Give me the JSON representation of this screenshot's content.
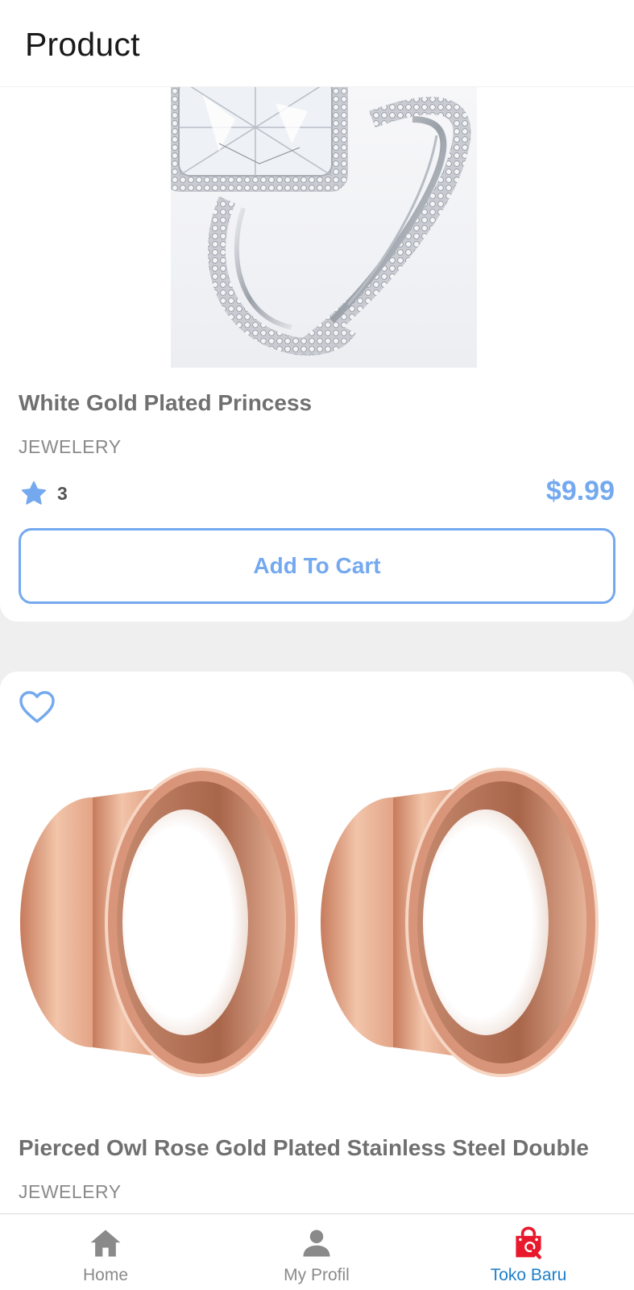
{
  "app_bar": {
    "title": "Product"
  },
  "products": [
    {
      "title": "White Gold Plated Princess",
      "category": "JEWELERY",
      "rating": "3",
      "price": "$9.99",
      "add_to_cart_label": "Add To Cart",
      "image": "ring-photo"
    },
    {
      "title": "Pierced Owl Rose Gold Plated Stainless Steel Double",
      "category": "JEWELERY",
      "favorite_icon": "heart-outline-icon",
      "image": "rose-gold-tunnels-photo"
    }
  ],
  "bottom_nav": {
    "items": [
      {
        "label": "Home",
        "icon": "home-icon"
      },
      {
        "label": "My Profil",
        "icon": "person-icon"
      },
      {
        "label": "Toko Baru",
        "icon": "shopping-bag-search-icon",
        "active": true
      }
    ]
  },
  "colors": {
    "accent": "#74a9ef",
    "active_nav": "#1e7fc9",
    "active_nav_icon": "#e8192c",
    "background": "#efefef"
  }
}
